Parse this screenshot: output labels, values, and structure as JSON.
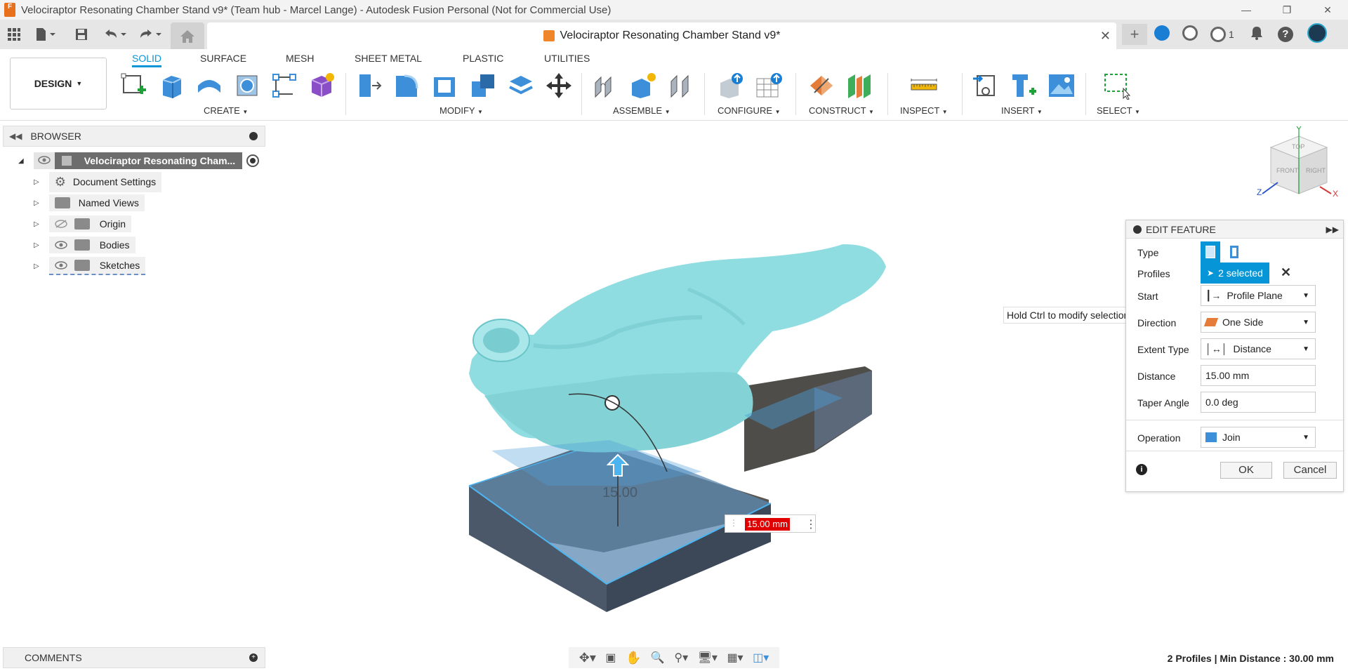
{
  "window": {
    "title": "Velociraptor Resonating Chamber Stand v9* (Team hub - Marcel Lange) - Autodesk Fusion Personal (Not for Commercial Use)",
    "app_icon_text": "F"
  },
  "document_tab": {
    "title": "Velociraptor Resonating Chamber Stand v9*"
  },
  "header_right": {
    "jobs_count": "1"
  },
  "toolbar": {
    "workspace_button": "DESIGN",
    "workspace_tabs": [
      "SOLID",
      "SURFACE",
      "MESH",
      "SHEET METAL",
      "PLASTIC",
      "UTILITIES"
    ],
    "active_tab": "SOLID",
    "groups": [
      "CREATE",
      "MODIFY",
      "ASSEMBLE",
      "CONFIGURE",
      "CONSTRUCT",
      "INSPECT",
      "INSERT",
      "SELECT"
    ]
  },
  "browser": {
    "title": "BROWSER",
    "root": "Velociraptor Resonating Cham...",
    "items": [
      "Document Settings",
      "Named Views",
      "Origin",
      "Bodies",
      "Sketches"
    ]
  },
  "viewcube": {
    "top": "TOP",
    "front": "FRONT",
    "right": "RIGHT",
    "axis_x": "X",
    "axis_y": "Y",
    "axis_z": "Z"
  },
  "edit_feature": {
    "title": "EDIT FEATURE",
    "type_label": "Type",
    "profiles_label": "Profiles",
    "profiles_value": "2 selected",
    "start_label": "Start",
    "start_value": "Profile Plane",
    "direction_label": "Direction",
    "direction_value": "One Side",
    "extent_label": "Extent Type",
    "extent_value": "Distance",
    "distance_label": "Distance",
    "distance_value": "15.00 mm",
    "taper_label": "Taper Angle",
    "taper_value": "0.0 deg",
    "operation_label": "Operation",
    "operation_value": "Join",
    "ok": "OK",
    "cancel": "Cancel"
  },
  "tooltip": "Hold Ctrl to modify selection",
  "viewport": {
    "dimension_input": "15.00 mm",
    "ghost_dimension": "15.00"
  },
  "comments": "COMMENTS",
  "status": "2 Profiles | Min Distance : 30.00 mm",
  "colors": {
    "accent": "#0696d7",
    "model": "#8fdde0",
    "stand": "#4d6075",
    "dimension_red": "#e10000"
  }
}
